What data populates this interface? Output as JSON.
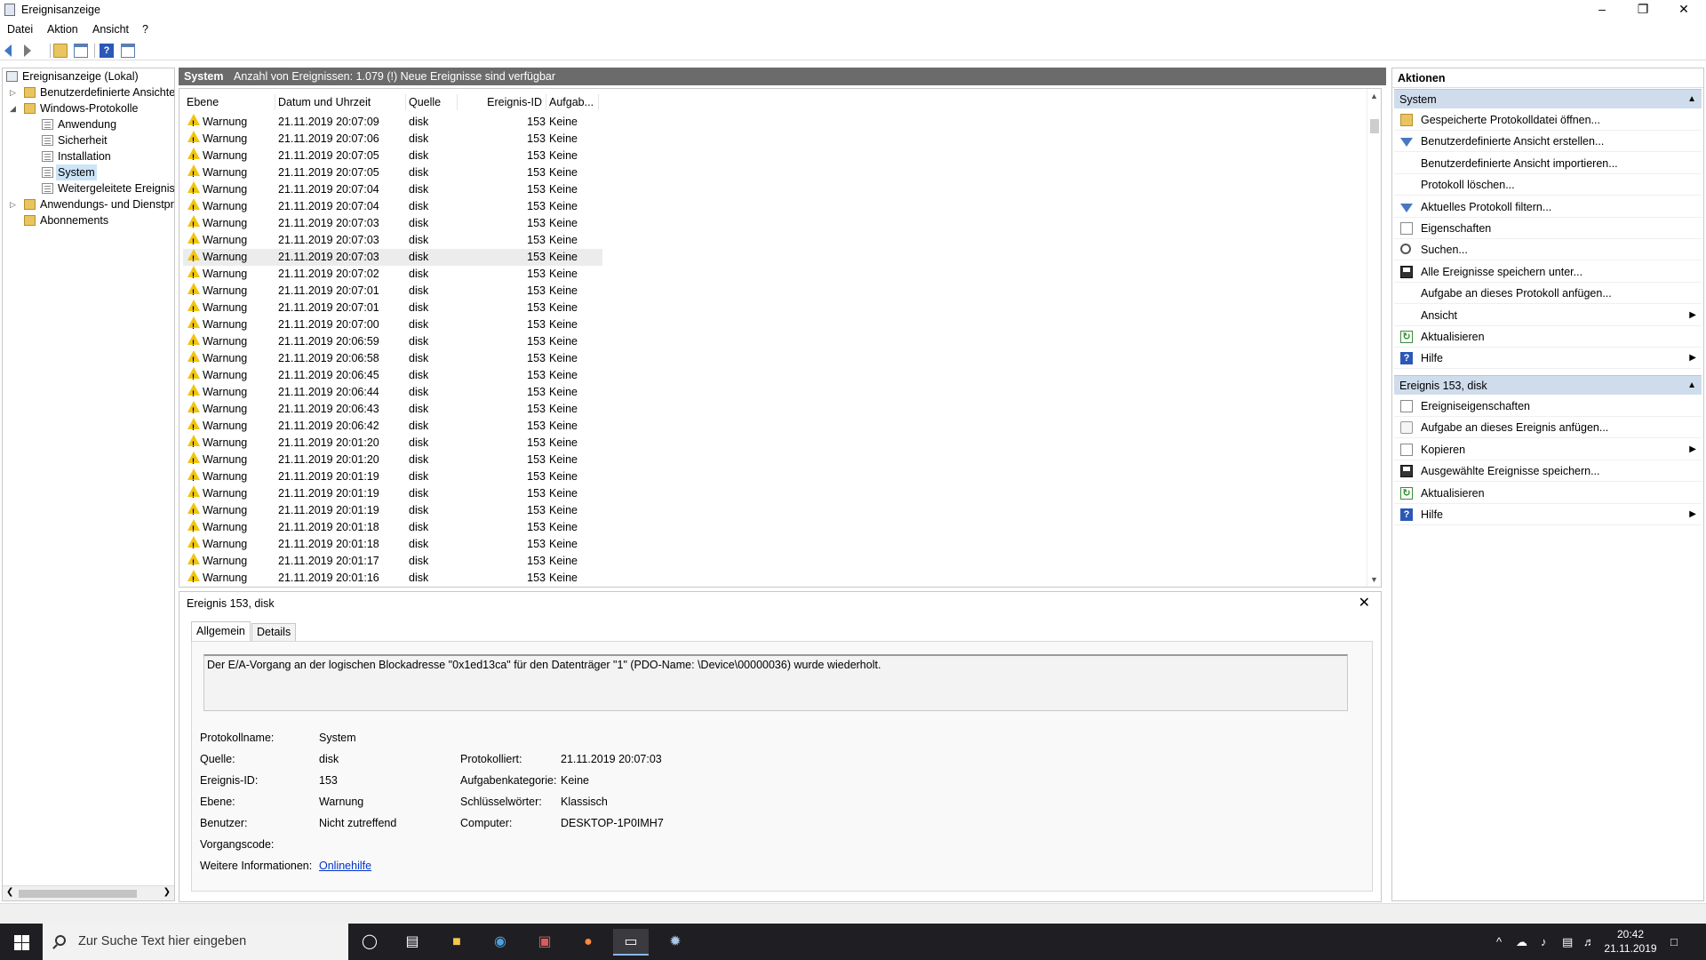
{
  "window": {
    "title": "Ereignisanzeige",
    "minimize": "–",
    "restore": "❐",
    "close": "✕"
  },
  "menu": [
    "Datei",
    "Aktion",
    "Ansicht",
    "?"
  ],
  "tree": {
    "root": "Ereignisanzeige (Lokal)",
    "custom_views": "Benutzerdefinierte Ansichten",
    "windows_logs": "Windows-Protokolle",
    "logs": [
      "Anwendung",
      "Sicherheit",
      "Installation",
      "System",
      "Weitergeleitete Ereignisse"
    ],
    "app_services": "Anwendungs- und Dienstprotokolle",
    "subscriptions": "Abonnements"
  },
  "center": {
    "log_name": "System",
    "event_count": "Anzahl von Ereignissen: 1.079 (!) Neue Ereignisse sind verfügbar"
  },
  "columns": [
    "Ebene",
    "Datum und Uhrzeit",
    "Quelle",
    "Ereignis-ID",
    "Aufgab..."
  ],
  "events": [
    {
      "level": "Warnung",
      "date": "21.11.2019 20:07:09",
      "source": "disk",
      "id": "153",
      "task": "Keine"
    },
    {
      "level": "Warnung",
      "date": "21.11.2019 20:07:06",
      "source": "disk",
      "id": "153",
      "task": "Keine"
    },
    {
      "level": "Warnung",
      "date": "21.11.2019 20:07:05",
      "source": "disk",
      "id": "153",
      "task": "Keine"
    },
    {
      "level": "Warnung",
      "date": "21.11.2019 20:07:05",
      "source": "disk",
      "id": "153",
      "task": "Keine"
    },
    {
      "level": "Warnung",
      "date": "21.11.2019 20:07:04",
      "source": "disk",
      "id": "153",
      "task": "Keine"
    },
    {
      "level": "Warnung",
      "date": "21.11.2019 20:07:04",
      "source": "disk",
      "id": "153",
      "task": "Keine"
    },
    {
      "level": "Warnung",
      "date": "21.11.2019 20:07:03",
      "source": "disk",
      "id": "153",
      "task": "Keine"
    },
    {
      "level": "Warnung",
      "date": "21.11.2019 20:07:03",
      "source": "disk",
      "id": "153",
      "task": "Keine"
    },
    {
      "level": "Warnung",
      "date": "21.11.2019 20:07:03",
      "source": "disk",
      "id": "153",
      "task": "Keine"
    },
    {
      "level": "Warnung",
      "date": "21.11.2019 20:07:02",
      "source": "disk",
      "id": "153",
      "task": "Keine"
    },
    {
      "level": "Warnung",
      "date": "21.11.2019 20:07:01",
      "source": "disk",
      "id": "153",
      "task": "Keine"
    },
    {
      "level": "Warnung",
      "date": "21.11.2019 20:07:01",
      "source": "disk",
      "id": "153",
      "task": "Keine"
    },
    {
      "level": "Warnung",
      "date": "21.11.2019 20:07:00",
      "source": "disk",
      "id": "153",
      "task": "Keine"
    },
    {
      "level": "Warnung",
      "date": "21.11.2019 20:06:59",
      "source": "disk",
      "id": "153",
      "task": "Keine"
    },
    {
      "level": "Warnung",
      "date": "21.11.2019 20:06:58",
      "source": "disk",
      "id": "153",
      "task": "Keine"
    },
    {
      "level": "Warnung",
      "date": "21.11.2019 20:06:45",
      "source": "disk",
      "id": "153",
      "task": "Keine"
    },
    {
      "level": "Warnung",
      "date": "21.11.2019 20:06:44",
      "source": "disk",
      "id": "153",
      "task": "Keine"
    },
    {
      "level": "Warnung",
      "date": "21.11.2019 20:06:43",
      "source": "disk",
      "id": "153",
      "task": "Keine"
    },
    {
      "level": "Warnung",
      "date": "21.11.2019 20:06:42",
      "source": "disk",
      "id": "153",
      "task": "Keine"
    },
    {
      "level": "Warnung",
      "date": "21.11.2019 20:01:20",
      "source": "disk",
      "id": "153",
      "task": "Keine"
    },
    {
      "level": "Warnung",
      "date": "21.11.2019 20:01:20",
      "source": "disk",
      "id": "153",
      "task": "Keine"
    },
    {
      "level": "Warnung",
      "date": "21.11.2019 20:01:19",
      "source": "disk",
      "id": "153",
      "task": "Keine"
    },
    {
      "level": "Warnung",
      "date": "21.11.2019 20:01:19",
      "source": "disk",
      "id": "153",
      "task": "Keine"
    },
    {
      "level": "Warnung",
      "date": "21.11.2019 20:01:19",
      "source": "disk",
      "id": "153",
      "task": "Keine"
    },
    {
      "level": "Warnung",
      "date": "21.11.2019 20:01:18",
      "source": "disk",
      "id": "153",
      "task": "Keine"
    },
    {
      "level": "Warnung",
      "date": "21.11.2019 20:01:18",
      "source": "disk",
      "id": "153",
      "task": "Keine"
    },
    {
      "level": "Warnung",
      "date": "21.11.2019 20:01:17",
      "source": "disk",
      "id": "153",
      "task": "Keine"
    },
    {
      "level": "Warnung",
      "date": "21.11.2019 20:01:16",
      "source": "disk",
      "id": "153",
      "task": "Keine"
    }
  ],
  "selected_row": 8,
  "detail": {
    "title": "Ereignis 153, disk",
    "close": "✕",
    "tabs": [
      "Allgemein",
      "Details"
    ],
    "message": "Der E/A-Vorgang an der logischen Blockadresse \"0x1ed13ca\" für den Datenträger \"1\" (PDO-Name: \\Device\\00000036) wurde wiederholt.",
    "fields": {
      "log_name_label": "Protokollname:",
      "log_name": "System",
      "source_label": "Quelle:",
      "source": "disk",
      "logged_label": "Protokolliert:",
      "logged": "21.11.2019 20:07:03",
      "event_id_label": "Ereignis-ID:",
      "event_id": "153",
      "task_cat_label": "Aufgabenkategorie:",
      "task_cat": "Keine",
      "level_label": "Ebene:",
      "level": "Warnung",
      "keywords_label": "Schlüsselwörter:",
      "keywords": "Klassisch",
      "user_label": "Benutzer:",
      "user": "Nicht zutreffend",
      "computer_label": "Computer:",
      "computer": "DESKTOP-1P0IMH7",
      "opcode_label": "Vorgangscode:",
      "more_info_label": "Weitere Informationen:",
      "more_info_link": "Onlinehilfe"
    }
  },
  "actions": {
    "header": "Aktionen",
    "section1": "System",
    "items1": [
      {
        "label": "Gespeicherte Protokolldatei öffnen...",
        "icon": "folder-open-icon",
        "submenu": false
      },
      {
        "label": "Benutzerdefinierte Ansicht erstellen...",
        "icon": "filter-icon",
        "submenu": false
      },
      {
        "label": "Benutzerdefinierte Ansicht importieren...",
        "icon": "",
        "submenu": false
      },
      {
        "label": "Protokoll löschen...",
        "icon": "",
        "submenu": false
      },
      {
        "label": "Aktuelles Protokoll filtern...",
        "icon": "filter-icon",
        "submenu": false
      },
      {
        "label": "Eigenschaften",
        "icon": "properties-icon",
        "submenu": false
      },
      {
        "label": "Suchen...",
        "icon": "binoculars-icon",
        "submenu": false
      },
      {
        "label": "Alle Ereignisse speichern unter...",
        "icon": "save-icon",
        "submenu": false
      },
      {
        "label": "Aufgabe an dieses Protokoll anfügen...",
        "icon": "",
        "submenu": false
      },
      {
        "label": "Ansicht",
        "icon": "",
        "submenu": true
      },
      {
        "label": "Aktualisieren",
        "icon": "refresh-icon",
        "submenu": false
      },
      {
        "label": "Hilfe",
        "icon": "help-icon",
        "submenu": true
      }
    ],
    "section2": "Ereignis 153, disk",
    "items2": [
      {
        "label": "Ereigniseigenschaften",
        "icon": "properties-icon",
        "submenu": false
      },
      {
        "label": "Aufgabe an dieses Ereignis anfügen...",
        "icon": "task-icon",
        "submenu": false
      },
      {
        "label": "Kopieren",
        "icon": "copy-icon",
        "submenu": true
      },
      {
        "label": "Ausgewählte Ereignisse speichern...",
        "icon": "save-icon",
        "submenu": false
      },
      {
        "label": "Aktualisieren",
        "icon": "refresh-icon",
        "submenu": false
      },
      {
        "label": "Hilfe",
        "icon": "help-icon",
        "submenu": true
      }
    ]
  },
  "taskbar": {
    "search_placeholder": "Zur Suche Text hier eingeben",
    "time": "20:42",
    "date": "21.11.2019"
  }
}
